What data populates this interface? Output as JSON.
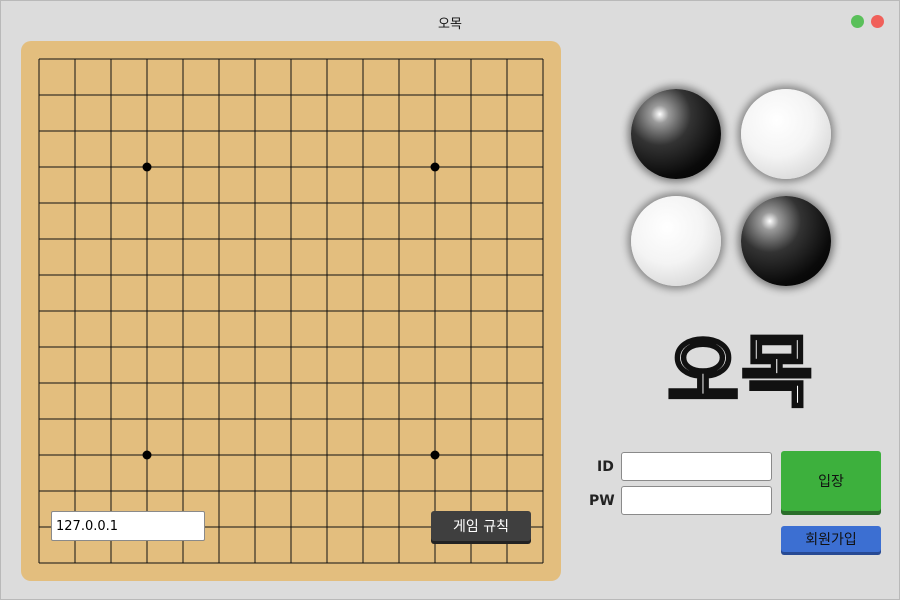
{
  "window": {
    "title": "오목"
  },
  "board": {
    "lines": 15,
    "star_points": [
      [
        3,
        3
      ],
      [
        11,
        3
      ],
      [
        3,
        11
      ],
      [
        11,
        11
      ]
    ]
  },
  "connection": {
    "server_address": "127.0.0.1"
  },
  "buttons": {
    "rules": "게임 규칙",
    "enter": "입장",
    "signup": "회원가입"
  },
  "login": {
    "id_label": "ID",
    "pw_label": "PW",
    "id_value": "",
    "pw_value": ""
  },
  "logo": {
    "text": "오목"
  },
  "stones": [
    "black",
    "white",
    "white",
    "black"
  ]
}
